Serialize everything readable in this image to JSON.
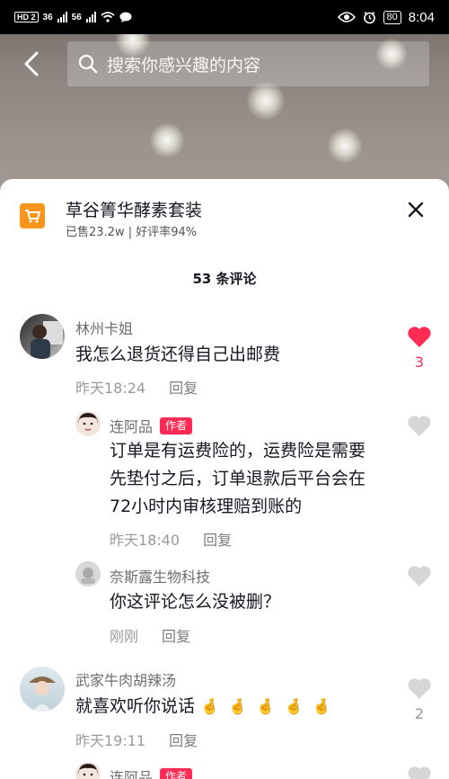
{
  "status_bar": {
    "left": "HD 2",
    "net1": "36",
    "net2": "56",
    "battery": "80",
    "time": "8:04"
  },
  "search": {
    "placeholder": "搜索你感兴趣的内容"
  },
  "product": {
    "title": "草谷箐华酵素套装",
    "subtitle": "已售23.2w | 好评率94%"
  },
  "comments_header": "53 条评论",
  "comments": [
    {
      "name": "林州卡姐",
      "text": "我怎么退货还得自己出邮费",
      "time": "昨天18:24",
      "reply": "回复",
      "likes": "3",
      "liked": true
    },
    {
      "name": "连阿品",
      "badge": "作者",
      "text_lines": [
        "订单是有运费险的，运费险是需要",
        "先垫付之后，订单退款后平台会在",
        "72小时内审核理赔到账的"
      ],
      "time": "昨天18:40",
      "reply": "回复"
    },
    {
      "name": "奈斯露生物科技",
      "text": "你这评论怎么没被删？",
      "time": "刚刚",
      "reply": "回复"
    },
    {
      "name": "武家牛肉胡辣汤",
      "text": "就喜欢听你说话",
      "emoji": "🤞",
      "emoji_count": 5,
      "time": "昨天19:11",
      "reply": "回复",
      "likes": "2"
    },
    {
      "name": "连阿品",
      "badge": "作者"
    }
  ],
  "colors": {
    "accent": "#fe2c55",
    "product_icon": "#f7951d",
    "text": "#161823",
    "muted": "#9a9a9a"
  }
}
